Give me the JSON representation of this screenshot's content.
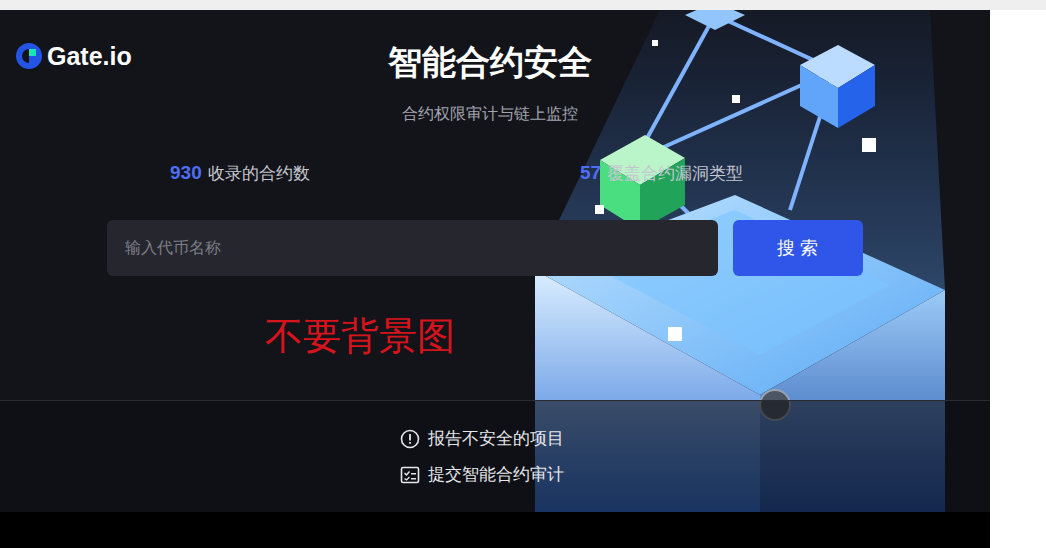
{
  "logo": "Gate.io",
  "title": "智能合约安全",
  "subtitle": "合约权限审计与链上监控",
  "stats": [
    {
      "value": "930",
      "label": "收录的合约数"
    },
    {
      "value": "57",
      "label": "覆盖合约漏洞类型"
    }
  ],
  "search": {
    "placeholder": "输入代币名称",
    "button": "搜 索"
  },
  "annotation": "不要背景图",
  "links": [
    {
      "label": "报告不安全的项目",
      "kind": "report"
    },
    {
      "label": "提交智能合约审计",
      "kind": "audit"
    }
  ]
}
